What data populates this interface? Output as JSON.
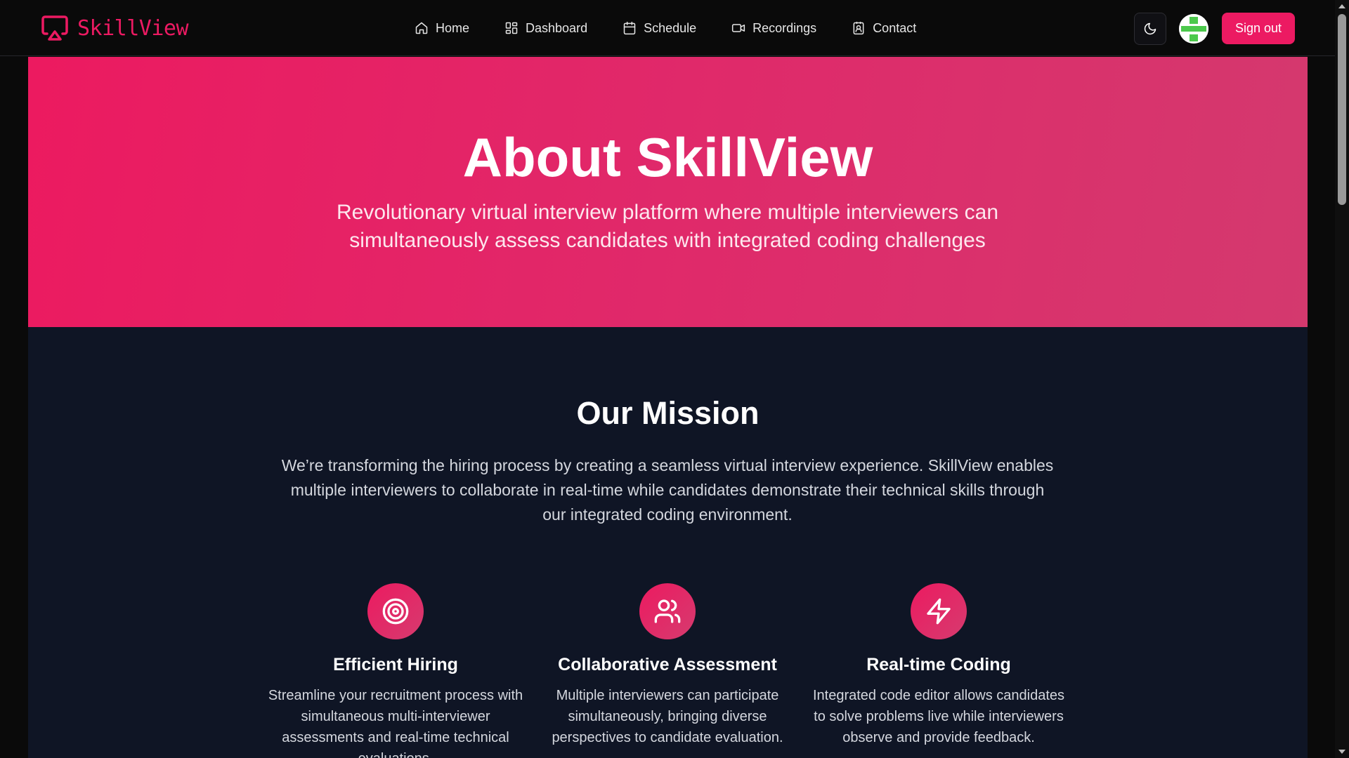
{
  "brand": {
    "name": "SkillView",
    "icon": "airplay-icon"
  },
  "nav": {
    "items": [
      {
        "label": "Home",
        "icon": "home-icon"
      },
      {
        "label": "Dashboard",
        "icon": "dashboard-icon"
      },
      {
        "label": "Schedule",
        "icon": "calendar-icon"
      },
      {
        "label": "Recordings",
        "icon": "video-icon"
      },
      {
        "label": "Contact",
        "icon": "contact-icon"
      }
    ],
    "theme_toggle_icon": "moon-icon",
    "signout_label": "Sign out"
  },
  "hero": {
    "title": "About SkillView",
    "subtitle": "Revolutionary virtual interview platform where multiple interviewers can simultaneously assess candidates with integrated coding challenges"
  },
  "mission": {
    "title": "Our Mission",
    "text": "We’re transforming the hiring process by creating a seamless virtual interview experience. SkillView enables multiple interviewers to collaborate in real-time while candidates demonstrate their technical skills through our integrated coding environment."
  },
  "features": [
    {
      "icon": "target-icon",
      "title": "Efficient Hiring",
      "text": "Streamline your recruitment process with simultaneous multi-interviewer assessments and real-time technical evaluations."
    },
    {
      "icon": "users-icon",
      "title": "Collaborative Assessment",
      "text": "Multiple interviewers can participate simultaneously, bringing diverse perspectives to candidate evaluation."
    },
    {
      "icon": "zap-icon",
      "title": "Real-time Coding",
      "text": "Integrated code editor allows candidates to solve problems live while interviewers observe and provide feedback."
    }
  ],
  "colors": {
    "accent": "#ec1a62",
    "background": "#0f1525",
    "navbar": "#0a0a0a"
  }
}
